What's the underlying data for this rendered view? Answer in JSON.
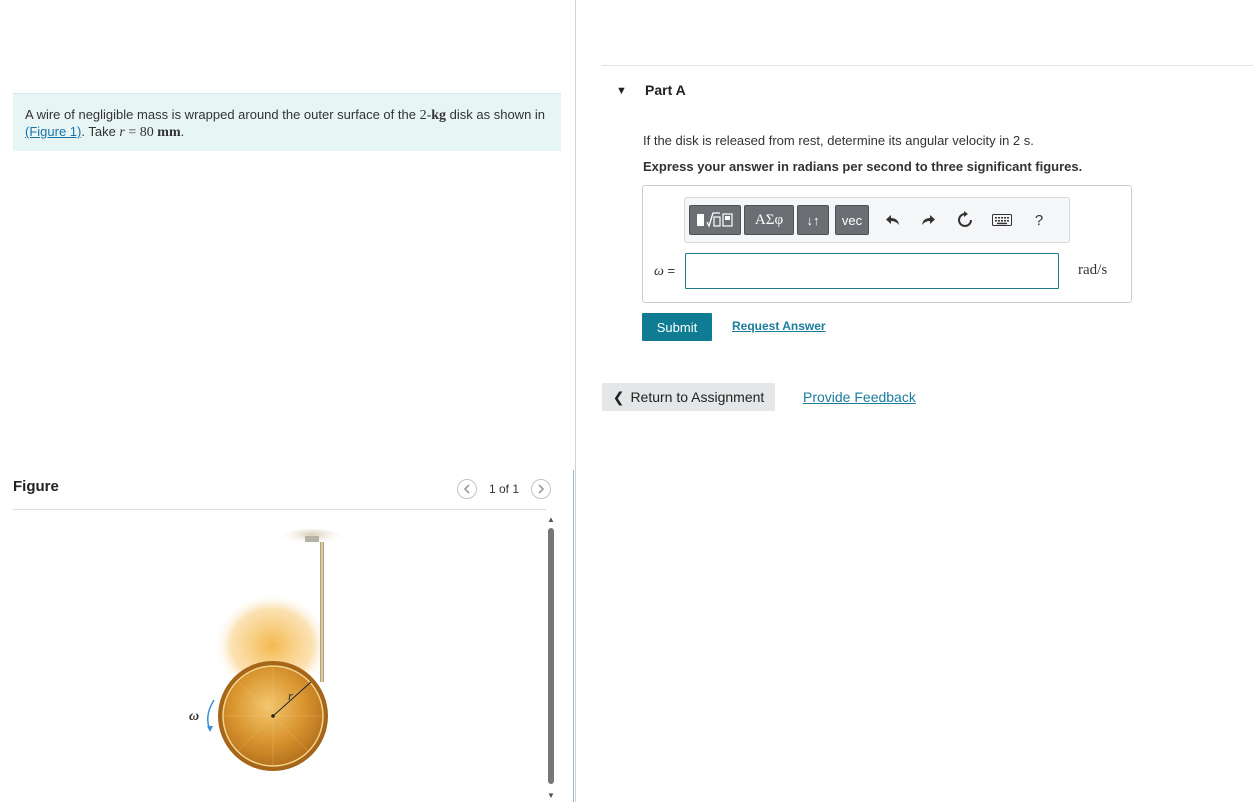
{
  "problem": {
    "text_before": "A wire of negligible mass is wrapped around the outer surface of the ",
    "mass": "2-",
    "mass_unit": "kg",
    "text_after": " disk as shown in",
    "link_text": "(Figure 1)",
    "take_text": ". Take ",
    "r_symbol": "r",
    "r_value": " = 80 ",
    "r_unit": "mm",
    "end": "."
  },
  "figure": {
    "title": "Figure",
    "count_label": "1 of 1",
    "omega_label": "ω",
    "r_label": "r"
  },
  "part": {
    "title": "Part A",
    "question": "If the disk is released from rest, determine its angular velocity in 2 s.",
    "instruction": "Express your answer in radians per second to three significant figures."
  },
  "toolbar": {
    "greek_label": "ΑΣφ",
    "arrows_label": "↓↑",
    "vec_label": "vec",
    "help_label": "?"
  },
  "answer": {
    "variable": "ω",
    "equals": " =",
    "value": "",
    "unit": "rad/s"
  },
  "actions": {
    "submit_label": "Submit",
    "request_answer_label": "Request Answer",
    "return_label": "Return to Assignment",
    "feedback_label": "Provide Feedback"
  },
  "colors": {
    "accent": "#0f7c94",
    "link": "#1a7c9c",
    "problem_bg": "#e8f5f5",
    "omega_arrow": "#3a8fd6"
  }
}
